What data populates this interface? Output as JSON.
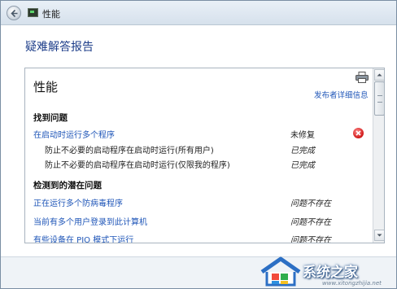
{
  "window": {
    "title": "性能"
  },
  "page": {
    "title": "疑难解答报告"
  },
  "report": {
    "section_title": "性能",
    "publisher_link": "发布者详细信息",
    "groups": [
      {
        "heading": "找到问题",
        "rows": [
          {
            "label": "在启动时运行多个程序",
            "status": "未修复",
            "type": "link",
            "italic": false,
            "error": true
          },
          {
            "label": "防止不必要的启动程序在启动时运行(所有用户)",
            "status": "已完成",
            "type": "sub",
            "italic": true,
            "error": false
          },
          {
            "label": "防止不必要的启动程序在启动时运行(仅限我的程序)",
            "status": "已完成",
            "type": "sub",
            "italic": true,
            "error": false
          }
        ]
      },
      {
        "heading": "检测到的潜在问题",
        "rows": [
          {
            "label": "正在运行多个防病毒程序",
            "status": "问题不存在",
            "type": "link",
            "italic": true,
            "error": false
          },
          {
            "label": "当前有多个用户登录到此计算机",
            "status": "问题不存在",
            "type": "link",
            "italic": true,
            "error": false
          },
          {
            "label": "有些设备在 PIO 模式下运行",
            "status": "问题不存在",
            "type": "link",
            "italic": true,
            "error": false
          }
        ]
      }
    ]
  },
  "watermark": {
    "text": "系统之家",
    "url": "www.xitongzhijia.net"
  },
  "icons": {
    "back": "back-arrow-icon",
    "app": "performance-monitor-icon",
    "print": "printer-icon",
    "error": "error-x-icon",
    "logo": "house-logo-icon"
  },
  "colors": {
    "link": "#1f56b8",
    "title": "#1e3e8a",
    "error": "#d01818"
  }
}
